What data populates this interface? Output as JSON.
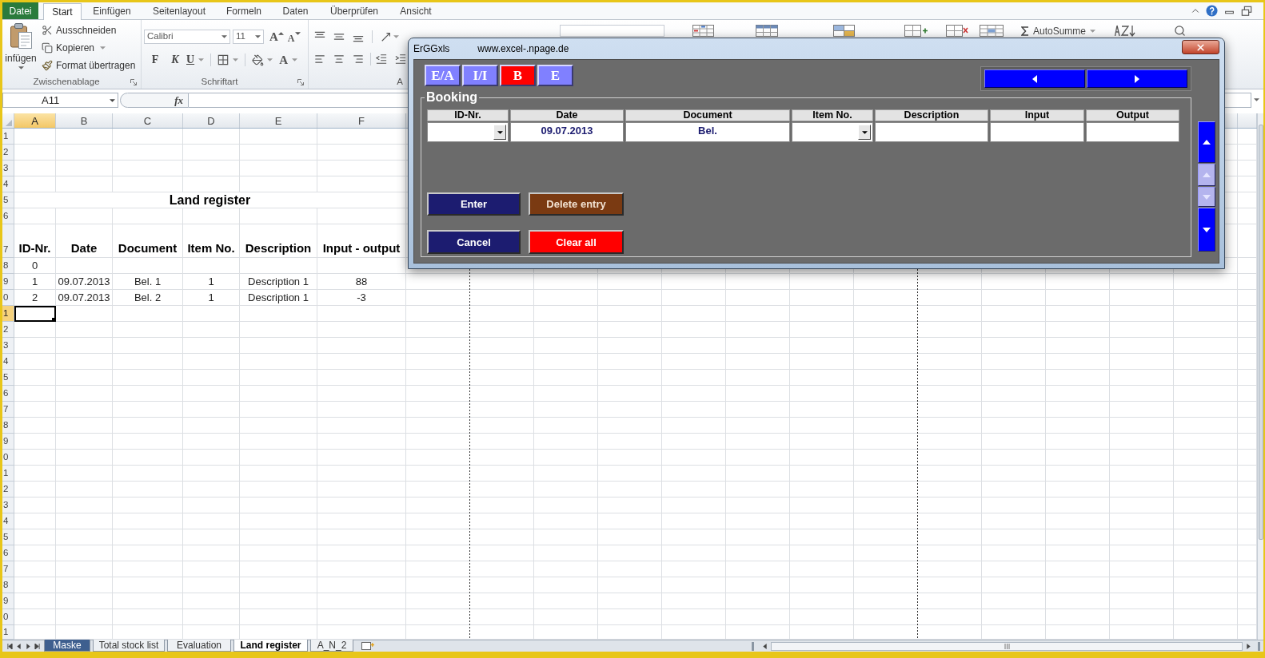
{
  "file_tab": "Datei",
  "ribbon_tabs": [
    {
      "label": "Start",
      "selected": true
    },
    {
      "label": "Einfügen",
      "selected": false
    },
    {
      "label": "Seitenlayout",
      "selected": false
    },
    {
      "label": "Formeln",
      "selected": false
    },
    {
      "label": "Daten",
      "selected": false
    },
    {
      "label": "Überprüfen",
      "selected": false
    },
    {
      "label": "Ansicht",
      "selected": false
    }
  ],
  "ribbon": {
    "clipboard": {
      "paste": "infügen",
      "commands": [
        {
          "label": "Ausschneiden",
          "kind": "cut"
        },
        {
          "label": "Kopieren",
          "kind": "copy"
        },
        {
          "label": "Format übertragen",
          "kind": "brush"
        }
      ],
      "label": "Zwischenablage"
    },
    "font": {
      "name": "Calibri",
      "size": "11",
      "grow_glyph": "A",
      "shrink_glyph": "A",
      "bold": "F",
      "italic": "K",
      "underline": "U",
      "color_glyph": "A",
      "label": "Schriftart"
    },
    "alignment": {
      "label": "A"
    },
    "editing": {
      "autosum": "AutoSumme"
    }
  },
  "formula_bar": {
    "name_box": "A11",
    "function_button": "fx"
  },
  "sheet": {
    "columns": [
      {
        "label": "A",
        "selected": true
      },
      {
        "label": "B",
        "selected": false
      },
      {
        "label": "C",
        "selected": false
      },
      {
        "label": "D",
        "selected": false
      },
      {
        "label": "E",
        "selected": false
      },
      {
        "label": "F",
        "selected": false
      }
    ],
    "row_headers": [
      {
        "label": "1",
        "selected": false
      },
      {
        "label": "2",
        "selected": false
      },
      {
        "label": "3",
        "selected": false
      },
      {
        "label": "4",
        "selected": false
      },
      {
        "label": "5",
        "selected": false
      },
      {
        "label": "6",
        "selected": false
      },
      {
        "label": "7",
        "selected": false
      },
      {
        "label": "8",
        "selected": false
      },
      {
        "label": "9",
        "selected": false
      },
      {
        "label": "0",
        "selected": false
      },
      {
        "label": "1",
        "selected": true
      },
      {
        "label": "2",
        "selected": false
      },
      {
        "label": "3",
        "selected": false
      },
      {
        "label": "4",
        "selected": false
      },
      {
        "label": "5",
        "selected": false
      },
      {
        "label": "6",
        "selected": false
      },
      {
        "label": "7",
        "selected": false
      },
      {
        "label": "8",
        "selected": false
      },
      {
        "label": "9",
        "selected": false
      },
      {
        "label": "0",
        "selected": false
      },
      {
        "label": "1",
        "selected": false
      },
      {
        "label": "2",
        "selected": false
      },
      {
        "label": "3",
        "selected": false
      },
      {
        "label": "4",
        "selected": false
      },
      {
        "label": "5",
        "selected": false
      },
      {
        "label": "6",
        "selected": false
      },
      {
        "label": "7",
        "selected": false
      },
      {
        "label": "8",
        "selected": false
      },
      {
        "label": "9",
        "selected": false
      },
      {
        "label": "0",
        "selected": false
      },
      {
        "label": "1",
        "selected": false
      }
    ],
    "title": "Land register",
    "header_row": [
      "ID-Nr.",
      "Date",
      "Document",
      "Item No.",
      "Description",
      "Input - output"
    ],
    "data_rows": [
      {
        "id": "0"
      },
      {
        "id": "1",
        "date": "09.07.2013",
        "document": "Bel. 1",
        "item_no": "1",
        "description": "Description 1",
        "input_output": "88"
      },
      {
        "id": "2",
        "date": "09.07.2013",
        "document": "Bel. 2",
        "item_no": "1",
        "description": "Description 1",
        "input_output": "-3"
      }
    ]
  },
  "dialog": {
    "title": "ErGGxls",
    "url": "www.excel-.npage.de",
    "mode_buttons": [
      {
        "label": "E/A",
        "selected": false
      },
      {
        "label": "I/I",
        "selected": false
      },
      {
        "label": "B",
        "selected": true
      },
      {
        "label": "E",
        "selected": false
      }
    ],
    "caption": "Booking",
    "fields": [
      {
        "label": "ID-Nr.",
        "kind": "combo"
      },
      {
        "label": "Date",
        "kind": "text",
        "value": "09.07.2013"
      },
      {
        "label": "Document",
        "kind": "text",
        "value": "Bel."
      },
      {
        "label": "Item No.",
        "kind": "combo"
      },
      {
        "label": "Description",
        "kind": "text"
      },
      {
        "label": "Input",
        "kind": "text"
      },
      {
        "label": "Output",
        "kind": "text"
      }
    ],
    "buttons": [
      {
        "label": "Enter",
        "kind": "action"
      },
      {
        "label": "Delete entry",
        "kind": "delete"
      },
      {
        "label": "Cancel",
        "kind": "action"
      },
      {
        "label": "Clear all",
        "kind": "danger"
      }
    ],
    "scroll_buttons": [
      {
        "kind": "up",
        "disabled": false
      },
      {
        "kind": "up",
        "disabled": true
      },
      {
        "kind": "down",
        "disabled": true
      },
      {
        "kind": "down",
        "disabled": false
      }
    ]
  },
  "sheet_tabs": [
    {
      "label": "Maske",
      "selected": false,
      "color": "#3e5f8f"
    },
    {
      "label": "Total stock list",
      "selected": false
    },
    {
      "label": "Evaluation",
      "selected": false
    },
    {
      "label": "Land register",
      "selected": true
    },
    {
      "label": "A_N_2",
      "selected": false
    }
  ]
}
